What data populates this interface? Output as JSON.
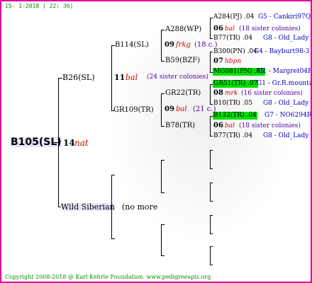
{
  "header": {
    "timestamp": "15- 1-2018 ( 22: 36)"
  },
  "footer": {
    "copyright": "Copyright 2008-2018 @ Karl Kehrle Foundation.   www.pedigreeapis.org"
  },
  "root": {
    "name": "B105(SL)",
    "number": "14",
    "code": "nat"
  },
  "gen2": {
    "sire": {
      "name": "B26(SL)",
      "number": "11",
      "code": "bal",
      "sisters": "(24 sister colonies)"
    },
    "dam": {
      "name": "Wild Siberian",
      "note": "(no more"
    }
  },
  "gen3": {
    "a": {
      "name": "B114(SL)"
    },
    "b": {
      "name": "GR109(TR)"
    }
  },
  "gen4": {
    "a": {
      "name": "A288(WP)",
      "number": "09",
      "code": "frkg",
      "sisters": "(18 c.)"
    },
    "b": {
      "name": "B59(BZF)"
    },
    "c": {
      "name": "GR22(TR)",
      "number": "09",
      "code": "bal",
      "sisters": "(21 c.)"
    },
    "d": {
      "name": "B78(TR)"
    }
  },
  "gen5": [
    {
      "left": "A284(PJ) .04",
      "right": "G5 - Cankiri97Q"
    },
    {
      "num": "06",
      "code": "bal",
      "sisters": "(18 sister colonies)"
    },
    {
      "left": "B77(TR) .04",
      "right": "G8 - Old_Lady"
    },
    {
      "left": "B300(PN) .04",
      "right": "G4 - Bayburt98-3"
    },
    {
      "num": "07",
      "code": "hbpn"
    },
    {
      "left": "MG081(PN) .05",
      "right": "G1 - Margret04R"
    },
    {
      "left": "GR51(TR) .07",
      "right": "G1 - Gr.R.mounta"
    },
    {
      "num": "08",
      "code": "mrk",
      "sisters": "(16 sister colonies)"
    },
    {
      "left": "B10(TR) .05",
      "right": "G8 - Old_Lady"
    },
    {
      "left": "B132(TR) .04",
      "right": "G7 - NO6294R"
    },
    {
      "num": "06",
      "code": "bal",
      "sisters": "(18 sister colonies)"
    },
    {
      "left": "B77(TR) .04",
      "right": "G8 - Old_Lady"
    }
  ]
}
